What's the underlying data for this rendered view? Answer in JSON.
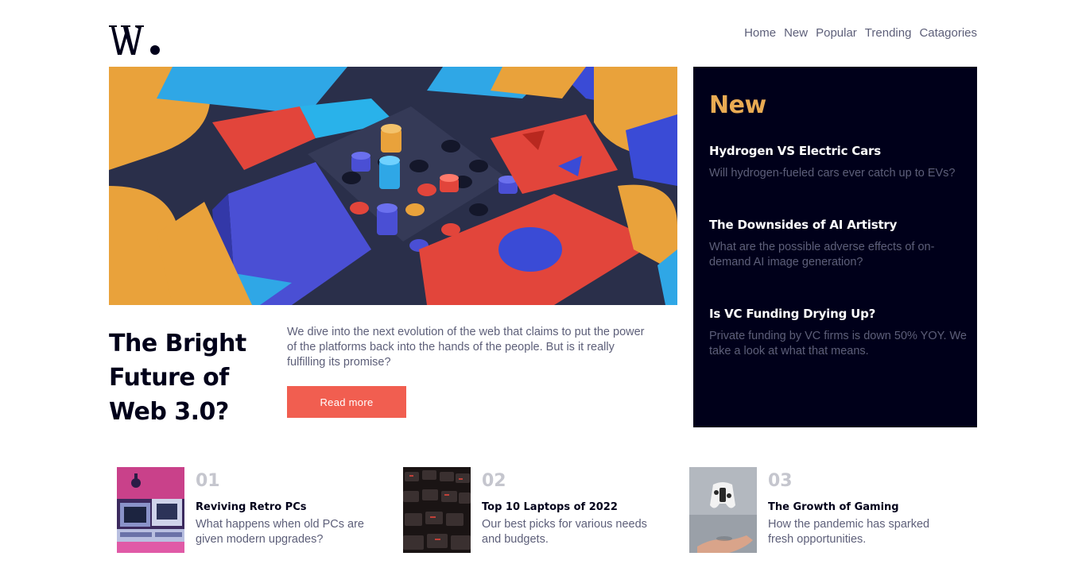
{
  "header": {
    "logo_text": "W.",
    "nav": [
      "Home",
      "New",
      "Popular",
      "Trending",
      "Catagories"
    ]
  },
  "hero": {
    "title_lines": [
      "The Bright",
      "Future of",
      "Web 3.0?"
    ],
    "description": "We dive into the next evolution of the web that claims to put the power of the platforms back into the hands of the people. But is it really fulfilling its promise?",
    "button_label": "Read more"
  },
  "new_panel": {
    "heading": "New",
    "items": [
      {
        "title": "Hydrogen VS Electric Cars",
        "desc": "Will hydrogen-fueled cars ever catch up to EVs?"
      },
      {
        "title": "The Downsides of AI Artistry",
        "desc": "What are the possible adverse effects of on-demand AI image generation?"
      },
      {
        "title": "Is VC Funding Drying Up?",
        "desc": "Private funding by VC firms is down 50% YOY. We take a look at what that means."
      }
    ]
  },
  "cards": [
    {
      "num": "01",
      "title": "Reviving Retro PCs",
      "desc": "What happens when old PCs are given modern upgrades?"
    },
    {
      "num": "02",
      "title": "Top 10 Laptops of 2022",
      "desc": "Our best picks for various needs and budgets."
    },
    {
      "num": "03",
      "title": "The Growth of Gaming",
      "desc": "How the pandemic has sparked fresh opportunities."
    }
  ],
  "colors": {
    "soft_red": "#f15e50",
    "soft_orange": "#e9ab53",
    "very_dark_blue": "#00001a",
    "grayish_blue": "#5d5f79",
    "grayish_light": "#c5c6ce"
  }
}
